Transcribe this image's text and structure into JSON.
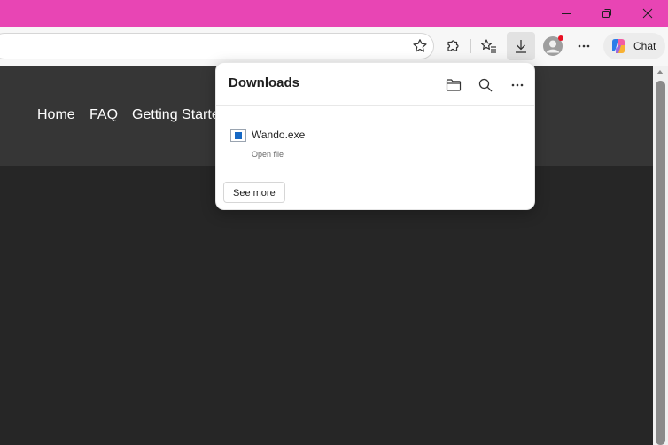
{
  "window": {
    "controls": [
      "minimize-icon",
      "restore-icon",
      "close-icon"
    ]
  },
  "toolbar": {
    "icons": [
      "star-icon",
      "extensions-icon",
      "favorites-icon",
      "download-icon",
      "profile-icon",
      "more-icon"
    ],
    "chat_label": "Chat"
  },
  "site": {
    "nav": [
      "Home",
      "FAQ",
      "Getting Starte"
    ]
  },
  "downloads": {
    "title": "Downloads",
    "icons": [
      "folder-icon",
      "search-icon",
      "more-icon"
    ],
    "items": [
      {
        "name": "Wando.exe",
        "status": "Open file",
        "icon": "exe-file-icon"
      }
    ],
    "see_more": "See more"
  },
  "colors": {
    "titlebar": "#e845b4",
    "page_bg": "#262626",
    "header_bg": "#363636",
    "notification_dot": "#e81123"
  }
}
